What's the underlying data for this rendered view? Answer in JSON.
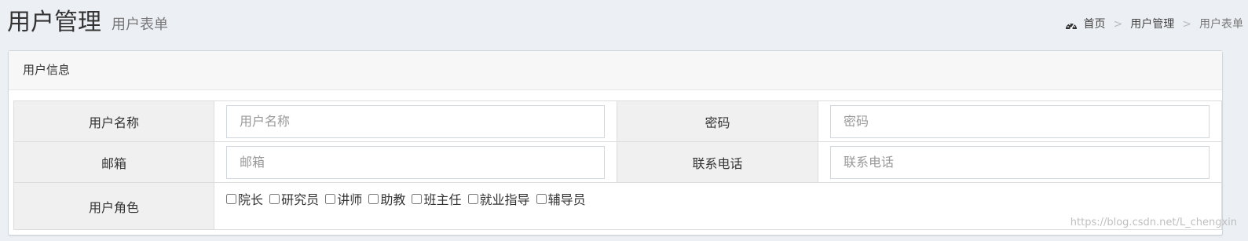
{
  "header": {
    "title": "用户管理",
    "subtitle": "用户表单"
  },
  "breadcrumb": {
    "home_icon": "dashboard-icon",
    "items": [
      "首页",
      "用户管理",
      "用户表单"
    ],
    "separator": ">"
  },
  "box": {
    "title": "用户信息"
  },
  "form": {
    "username": {
      "label": "用户名称",
      "placeholder": "用户名称",
      "value": ""
    },
    "password": {
      "label": "密码",
      "placeholder": "密码",
      "value": ""
    },
    "email": {
      "label": "邮箱",
      "placeholder": "邮箱",
      "value": ""
    },
    "phone": {
      "label": "联系电话",
      "placeholder": "联系电话",
      "value": ""
    },
    "roles": {
      "label": "用户角色",
      "options": [
        "院长",
        "研究员",
        "讲师",
        "助教",
        "班主任",
        "就业指导",
        "辅导员"
      ]
    }
  },
  "watermark": "https://blog.csdn.net/L_chengxin",
  "colors": {
    "page_background": "#ecf0f5",
    "label_cell_background": "#f0f0f0",
    "border": "#d2d6de"
  }
}
